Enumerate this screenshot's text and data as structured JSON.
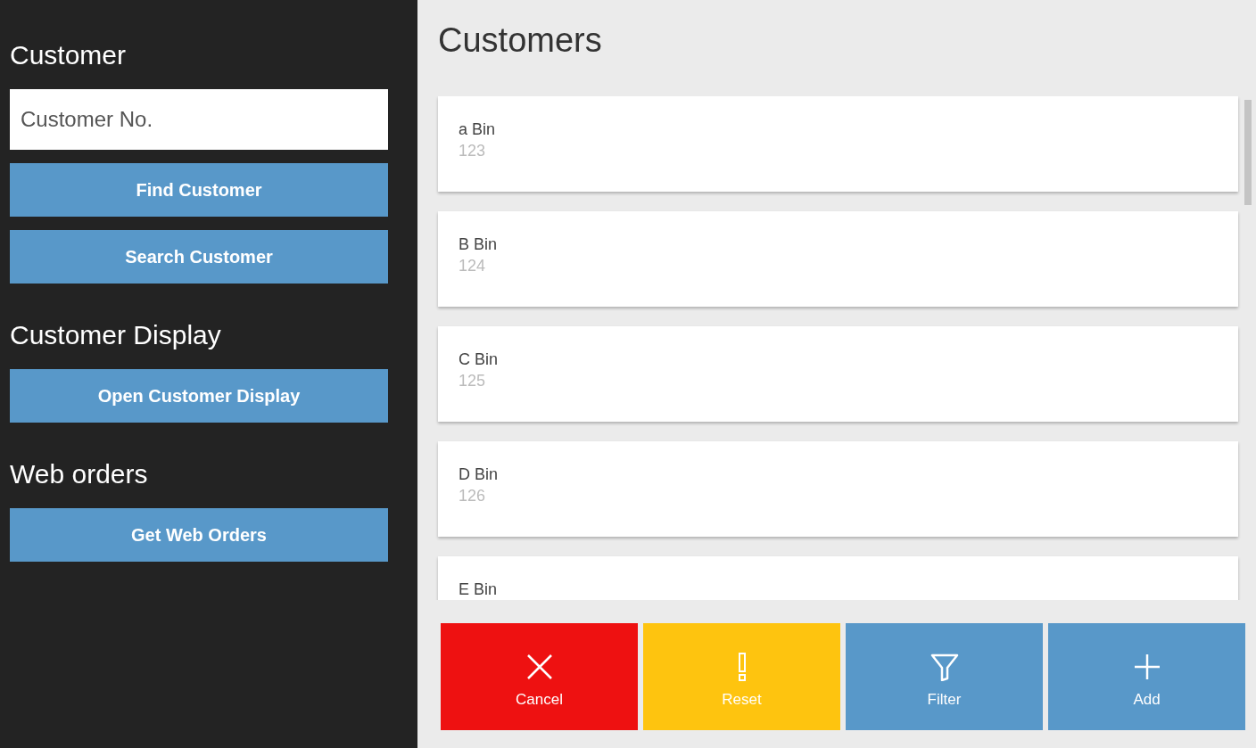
{
  "sidebar": {
    "sections": [
      {
        "heading": "Customer",
        "field": {
          "placeholder": "Customer No."
        },
        "buttons": [
          "Find Customer",
          "Search Customer"
        ]
      },
      {
        "heading": "Customer Display",
        "buttons": [
          "Open Customer Display"
        ]
      },
      {
        "heading": "Web orders",
        "buttons": [
          "Get Web Orders"
        ]
      }
    ]
  },
  "main": {
    "title": "Customers",
    "customers": [
      {
        "name": "a Bin",
        "number": "123"
      },
      {
        "name": "B Bin",
        "number": "124"
      },
      {
        "name": "C Bin",
        "number": "125"
      },
      {
        "name": "D Bin",
        "number": "126"
      },
      {
        "name": "E Bin"
      }
    ],
    "actions": [
      {
        "kind": "cancel",
        "label": "Cancel",
        "color": "#ee1111"
      },
      {
        "kind": "reset",
        "label": "Reset",
        "color": "#fec40f"
      },
      {
        "kind": "filter",
        "label": "Filter",
        "color": "#5898c9"
      },
      {
        "kind": "add",
        "label": "Add",
        "color": "#5898c9"
      }
    ]
  }
}
